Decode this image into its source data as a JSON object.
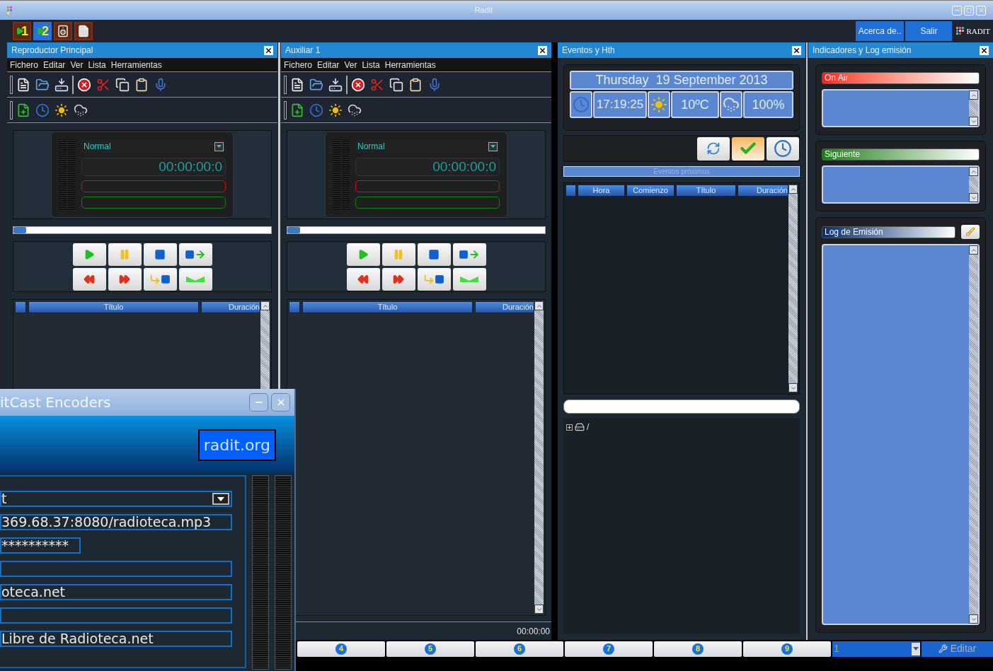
{
  "window": {
    "title": "Radit"
  },
  "launchers": [
    {
      "kind": "player",
      "label": "1",
      "selected": false
    },
    {
      "kind": "player",
      "label": "2",
      "selected": true
    },
    {
      "kind": "speaker",
      "selected": false
    },
    {
      "kind": "document",
      "selected": false
    }
  ],
  "top_buttons": [
    "Acerca de..",
    "Salir"
  ],
  "logo": "RADIT",
  "players": [
    {
      "title": "Reproductor Principal",
      "menu": [
        "Fichero",
        "Editar",
        "Ver",
        "Lista",
        "Herramientas"
      ],
      "mode": "Normal",
      "time": "00:00:00:0",
      "progress": {
        "level": 0.05
      },
      "columns": [
        "Título",
        "Duración"
      ]
    },
    {
      "title": "Auxiliar 1",
      "menu": [
        "Fichero",
        "Editar",
        "Ver",
        "Lista",
        "Herramientas"
      ],
      "mode": "Normal",
      "time": "00:00:00:0",
      "progress": {
        "level": 0.05
      },
      "columns": [
        "Título",
        "Duración"
      ],
      "footer_time": "00:00:00"
    }
  ],
  "events": {
    "title": "Eventos y Hth",
    "date": "Thursday  19 September 2013",
    "time": "17:19:25",
    "temperature": "10ºC",
    "humidity": "100%",
    "actions": [
      {
        "kind": "refresh",
        "selected": false
      },
      {
        "kind": "confirm",
        "selected": true
      },
      {
        "kind": "clock",
        "selected": false
      }
    ],
    "upcoming_label": "Eventos próximos",
    "columns": [
      "Hora",
      "Comienzo",
      "Título",
      "Duración"
    ],
    "tree": [
      {
        "label": "/",
        "expanded": false
      }
    ]
  },
  "indicators": {
    "title": "Indicadores y Log emisión",
    "sections": [
      {
        "kind": "on_air",
        "label": "On Air"
      },
      {
        "kind": "next",
        "label": "Siguiente"
      },
      {
        "kind": "log",
        "label": "Log de Emisión"
      }
    ]
  },
  "bottom_bar": {
    "slots": [
      "4",
      "5",
      "6",
      "7",
      "8",
      "9"
    ],
    "select": "1",
    "edit": "Editar"
  },
  "encoder_window": {
    "title": "itCast Encoders",
    "link": "radit.org",
    "fields": [
      {
        "kind": "select",
        "value": "t"
      },
      {
        "kind": "text",
        "value": "369.68.37:8080/radioteca.mp3"
      },
      {
        "kind": "password",
        "value": "**********"
      },
      {
        "kind": "text"
      },
      {
        "kind": "text",
        "value": "oteca.net"
      },
      {
        "kind": "text"
      },
      {
        "kind": "text",
        "value": "Libre de Radioteca.net"
      }
    ]
  }
}
